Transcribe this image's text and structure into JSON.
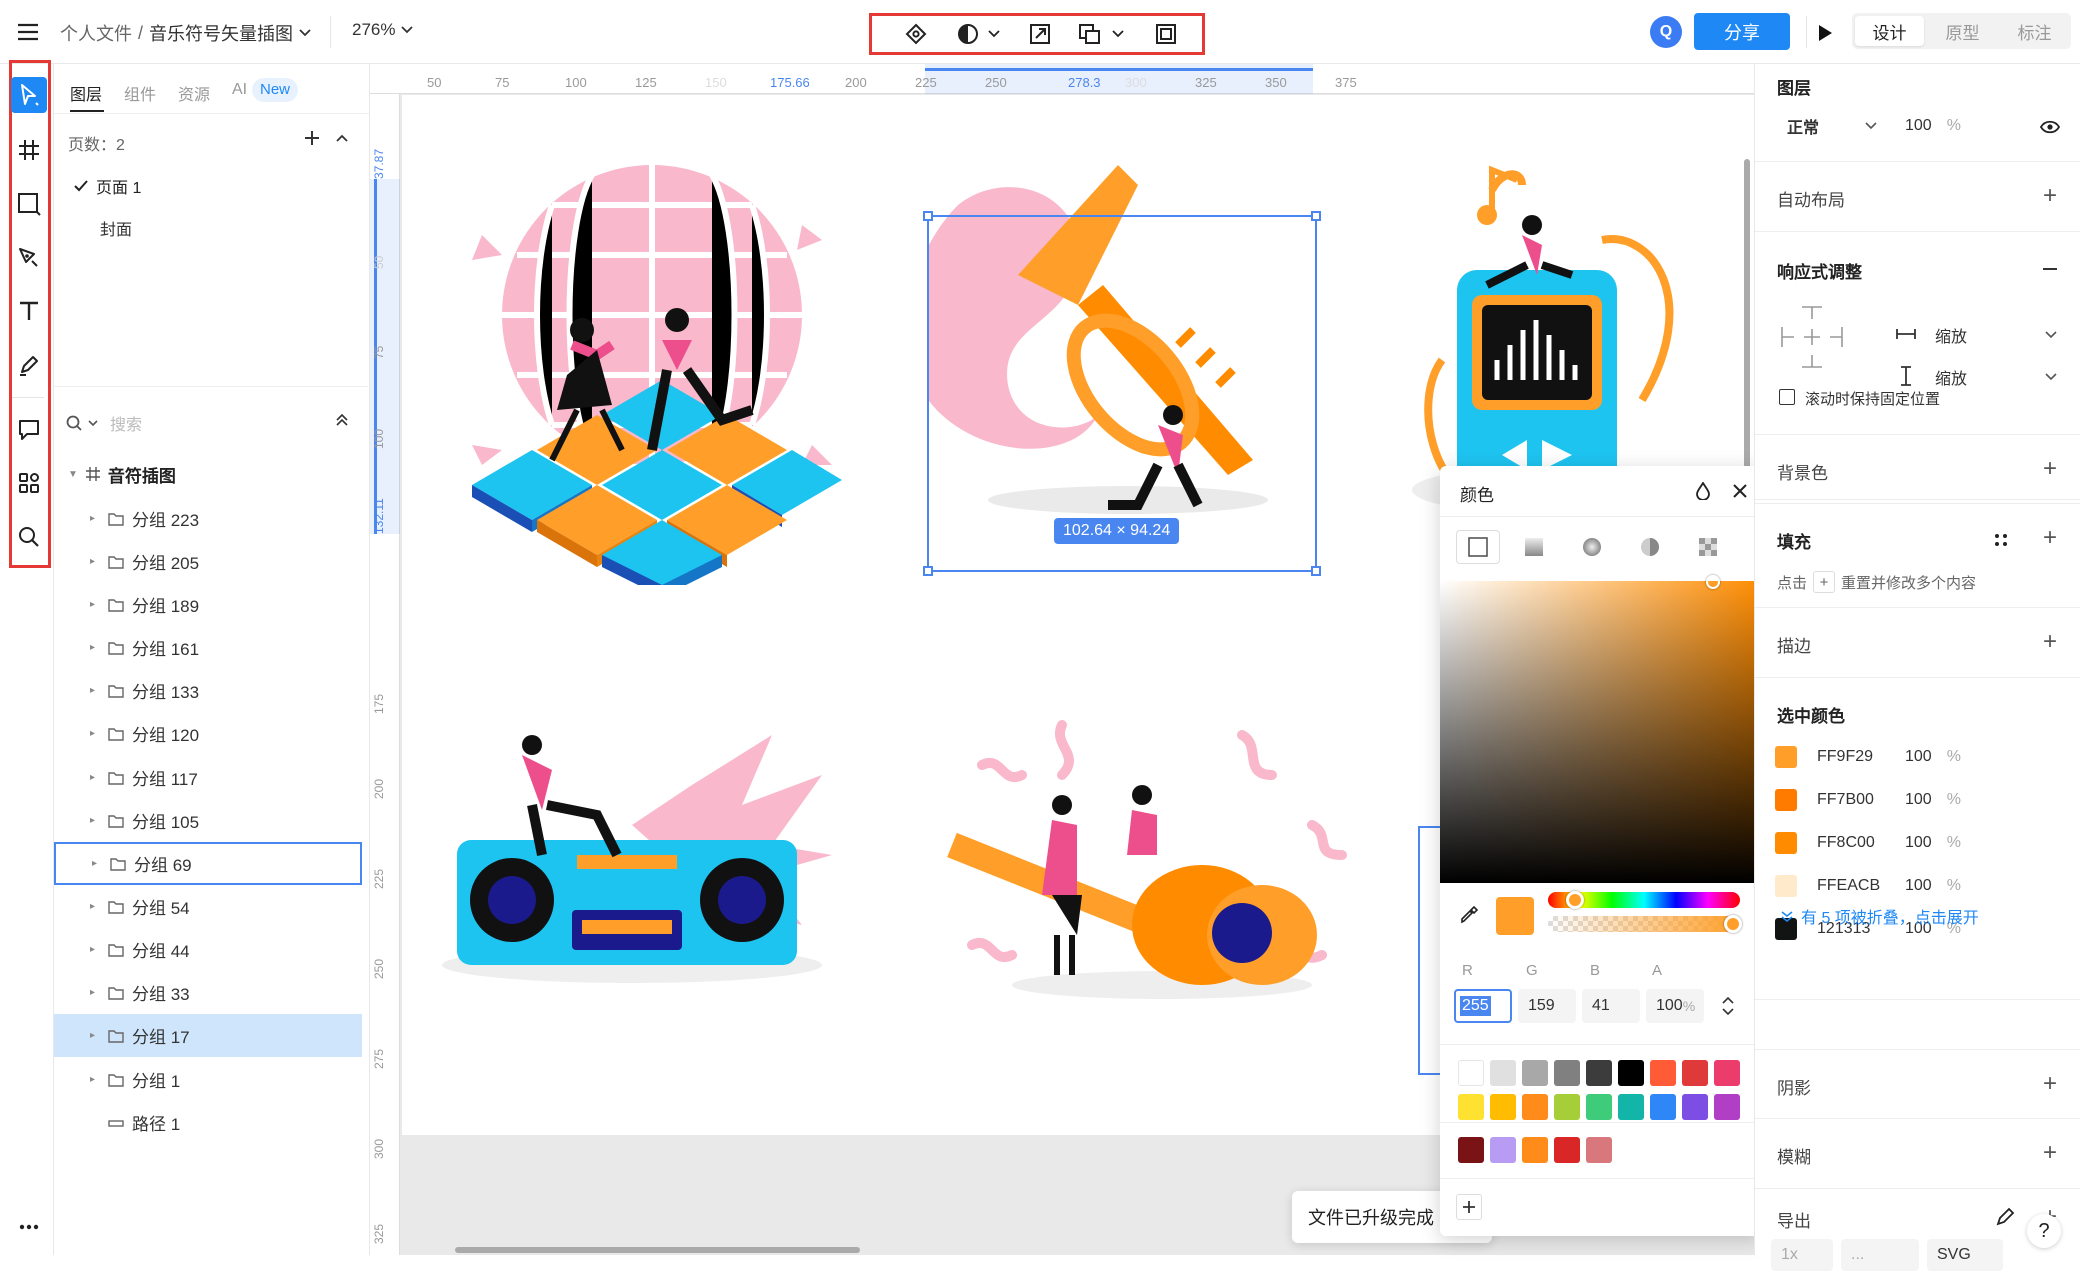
{
  "topbar": {
    "breadcrumb_root": "个人文件",
    "breadcrumb_sep": "/",
    "file_name": "音乐符号矢量插图",
    "zoom": "276%",
    "avatar_letter": "Q",
    "share_label": "分享",
    "mode_tabs": [
      "设计",
      "原型",
      "标注"
    ]
  },
  "left_panel": {
    "tabs": [
      "图层",
      "组件",
      "资源",
      "AI"
    ],
    "ai_badge": "New",
    "pages_label": "页数：2",
    "pages": [
      "页面 1",
      "封面"
    ],
    "search_placeholder": "搜索",
    "frame_name": "音符插图",
    "layers": [
      "分组 223",
      "分组 205",
      "分组 189",
      "分组 161",
      "分组 133",
      "分组 120",
      "分组 117",
      "分组 105",
      "分组 69",
      "分组 54",
      "分组 44",
      "分组 33",
      "分组 17",
      "分组 1",
      "路径 1"
    ]
  },
  "rulers": {
    "top": [
      "50",
      "75",
      "100",
      "125",
      "150",
      "175.66",
      "200",
      "225",
      "250",
      "278.3",
      "300",
      "325",
      "350",
      "375"
    ],
    "left": [
      "37.87",
      "50",
      "75",
      "100",
      "132.11",
      "175",
      "200",
      "225",
      "250",
      "275",
      "300",
      "325"
    ]
  },
  "canvas": {
    "selection_size": "102.64 × 94.24",
    "toast": "文件已升级完成"
  },
  "color_picker": {
    "title": "颜色",
    "channel_labels": [
      "R",
      "G",
      "B",
      "A"
    ],
    "r": "255",
    "g": "159",
    "b": "41",
    "a": "100",
    "a_unit": "%",
    "current_color": "#FF9F29",
    "palette_row1": [
      "#ffffff",
      "#e0e0e0",
      "#a8a8a8",
      "#808080",
      "#3c3c3c",
      "#000000",
      "#ff5b37",
      "#e0393a",
      "#ec3c6b"
    ],
    "palette_row2": [
      "#ffe231",
      "#ffbc00",
      "#ff8c1a",
      "#a6ce39",
      "#3ecc7a",
      "#13b5a8",
      "#2f86f6",
      "#7c4ee4",
      "#b13fc6"
    ],
    "recent_colors": [
      "#7a1315",
      "#b89cf4",
      "#ff8c1a",
      "#d92727",
      "#d9787c"
    ]
  },
  "right_panel": {
    "layer_title": "图层",
    "blend_mode": "正常",
    "opacity": "100",
    "opacity_unit": "%",
    "auto_layout": "自动布局",
    "responsive": "响应式调整",
    "h_constraint": "缩放",
    "v_constraint": "缩放",
    "fix_scroll": "滚动时保持固定位置",
    "background": "背景色",
    "fill": "填充",
    "fill_hint_prefix": "点击",
    "fill_hint_suffix": "重置并修改多个内容",
    "stroke": "描边",
    "selected_colors_title": "选中颜色",
    "selected_colors": [
      {
        "hex": "FF9F29",
        "color": "#FF9F29",
        "opacity": "100"
      },
      {
        "hex": "FF7B00",
        "color": "#FF7B00",
        "opacity": "100"
      },
      {
        "hex": "FF8C00",
        "color": "#FF8C00",
        "opacity": "100"
      },
      {
        "hex": "FFEACB",
        "color": "#FFEACB",
        "opacity": "100"
      },
      {
        "hex": "121313",
        "color": "#121313",
        "opacity": "100"
      }
    ],
    "collapsed_note": "有 5 项被折叠，点击展开",
    "shadow": "阴影",
    "blur": "模糊",
    "export": "导出",
    "export_scale": "1x",
    "export_suffix": "...",
    "export_format": "SVG"
  },
  "colors": {
    "accent": "#1e88f5",
    "orange": "#ff9f29",
    "pink": "#f9b8cb",
    "cyan": "#1ec4f0",
    "selection": "#4a86f0"
  }
}
